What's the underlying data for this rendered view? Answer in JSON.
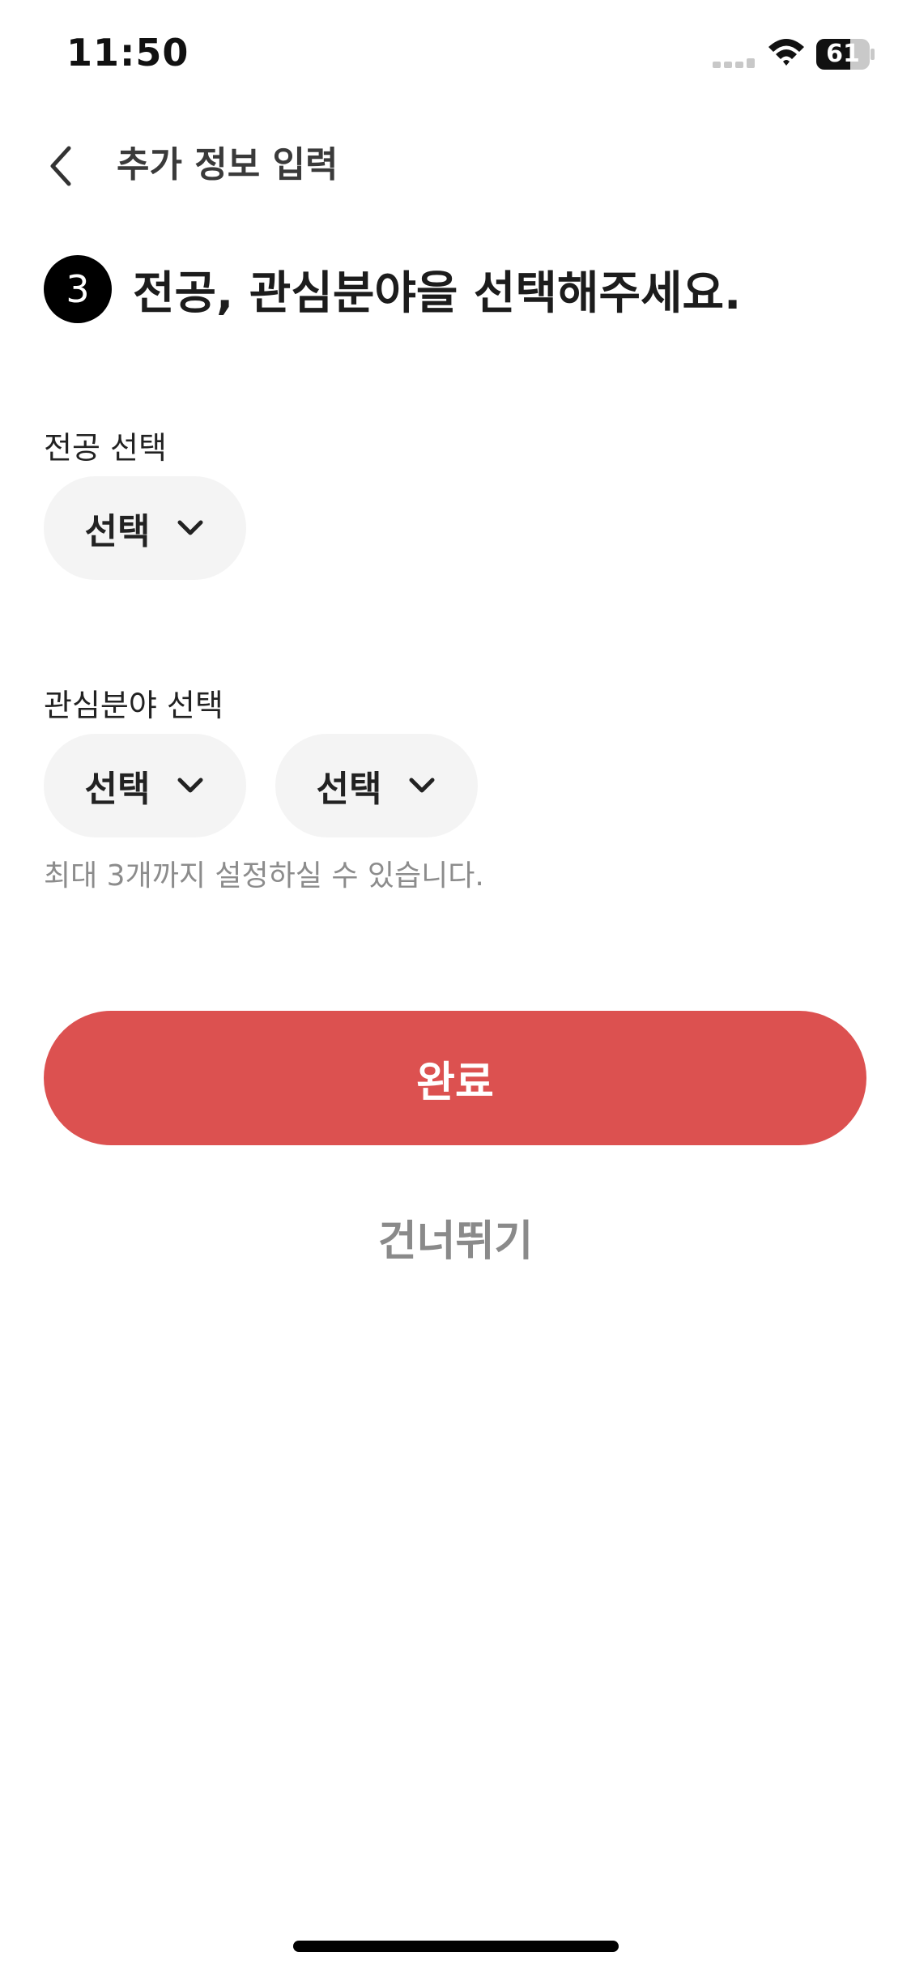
{
  "status_bar": {
    "time": "11:50",
    "battery_level": "61",
    "icons": [
      "signal-icon",
      "wifi-icon",
      "battery-icon"
    ]
  },
  "header": {
    "back_icon": "chevron-left-icon",
    "title": "추가 정보 입력"
  },
  "step": {
    "number": "3",
    "title": "전공, 관심분야을 선택해주세요."
  },
  "major": {
    "label": "전공 선택",
    "dropdown": {
      "selected": "선택",
      "icon": "chevron-down-icon"
    }
  },
  "interest": {
    "label": "관심분야 선택",
    "dropdowns": [
      {
        "selected": "선택",
        "icon": "chevron-down-icon"
      },
      {
        "selected": "선택",
        "icon": "chevron-down-icon"
      }
    ],
    "helper": "최대 3개까지 설정하실 수 있습니다."
  },
  "actions": {
    "complete_label": "완료",
    "skip_label": "건너뛰기"
  },
  "colors": {
    "primary": "#dc5150",
    "pill_bg": "#f4f4f4",
    "helper_text": "#8c8c8c",
    "skip_text": "#8a8a8a"
  }
}
